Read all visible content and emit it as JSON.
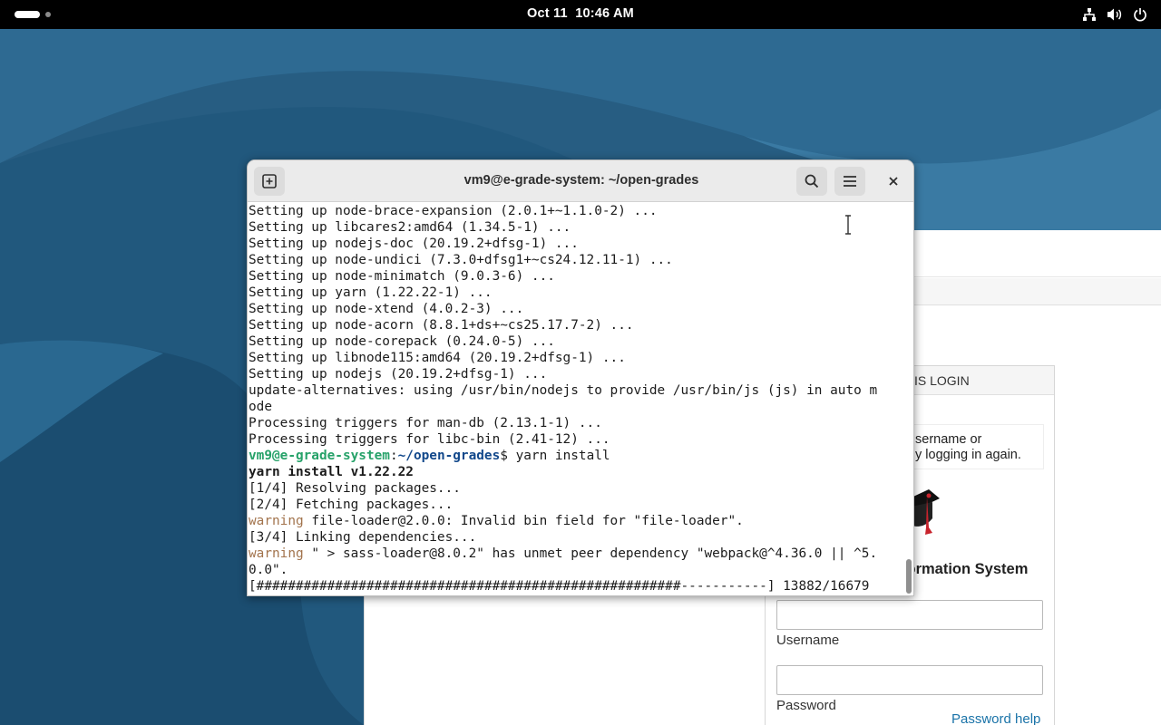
{
  "topbar": {
    "date": "Oct 11",
    "time": "10:46 AM",
    "tray_icons": [
      "network-icon",
      "volume-icon",
      "power-icon"
    ]
  },
  "terminal": {
    "title": "vm9@e-grade-system: ~/open-grades",
    "new_tab_icon": "new-tab-icon",
    "search_icon": "search-icon",
    "menu_icon": "hamburger-menu-icon",
    "close_icon": "close-icon",
    "lines": [
      {
        "text": "Setting up node-brace-expansion (2.0.1+~1.1.0-2) ..."
      },
      {
        "text": "Setting up libcares2:amd64 (1.34.5-1) ..."
      },
      {
        "text": "Setting up nodejs-doc (20.19.2+dfsg-1) ..."
      },
      {
        "text": "Setting up node-undici (7.3.0+dfsg1+~cs24.12.11-1) ..."
      },
      {
        "text": "Setting up node-minimatch (9.0.3-6) ..."
      },
      {
        "text": "Setting up yarn (1.22.22-1) ..."
      },
      {
        "text": "Setting up node-xtend (4.0.2-3) ..."
      },
      {
        "text": "Setting up node-acorn (8.8.1+ds+~cs25.17.7-2) ..."
      },
      {
        "text": "Setting up node-corepack (0.24.0-5) ..."
      },
      {
        "text": "Setting up libnode115:amd64 (20.19.2+dfsg-1) ..."
      },
      {
        "text": "Setting up nodejs (20.19.2+dfsg-1) ..."
      },
      {
        "text": "update-alternatives: using /usr/bin/nodejs to provide /usr/bin/js (js) in auto m"
      },
      {
        "text": "ode"
      },
      {
        "text": "Processing triggers for man-db (2.13.1-1) ..."
      },
      {
        "text": "Processing triggers for libc-bin (2.41-12) ..."
      }
    ],
    "prompt": {
      "user_host": "vm9@e-grade-system",
      "sep": ":",
      "path": "~/open-grades",
      "symbol": "$ ",
      "command": "yarn install"
    },
    "yarn_header": "yarn install v1.22.22",
    "step1": "[1/4] Resolving packages...",
    "step2": "[2/4] Fetching packages...",
    "warning1": {
      "tag": "warning",
      "text": " file-loader@2.0.0: Invalid bin field for \"file-loader\"."
    },
    "step3": "[3/4] Linking dependencies...",
    "warning2": {
      "tag": "warning",
      "text": " \" > sass-loader@8.0.2\" has unmet peer dependency \"webpack@^4.36.0 || ^5."
    },
    "warning2_cont": "0.0\".",
    "progress_line": "[######################################################-----------] 13882/16679",
    "progress_fraction": 0.832
  },
  "login_page": {
    "header": "IS LOGIN",
    "message_line1": "sername or",
    "message_line2": "y logging in again.",
    "title": "formation System",
    "username_label": "Username",
    "password_label": "Password",
    "password_help": "Password help",
    "logo_icon": "graduation-cap-icon"
  }
}
